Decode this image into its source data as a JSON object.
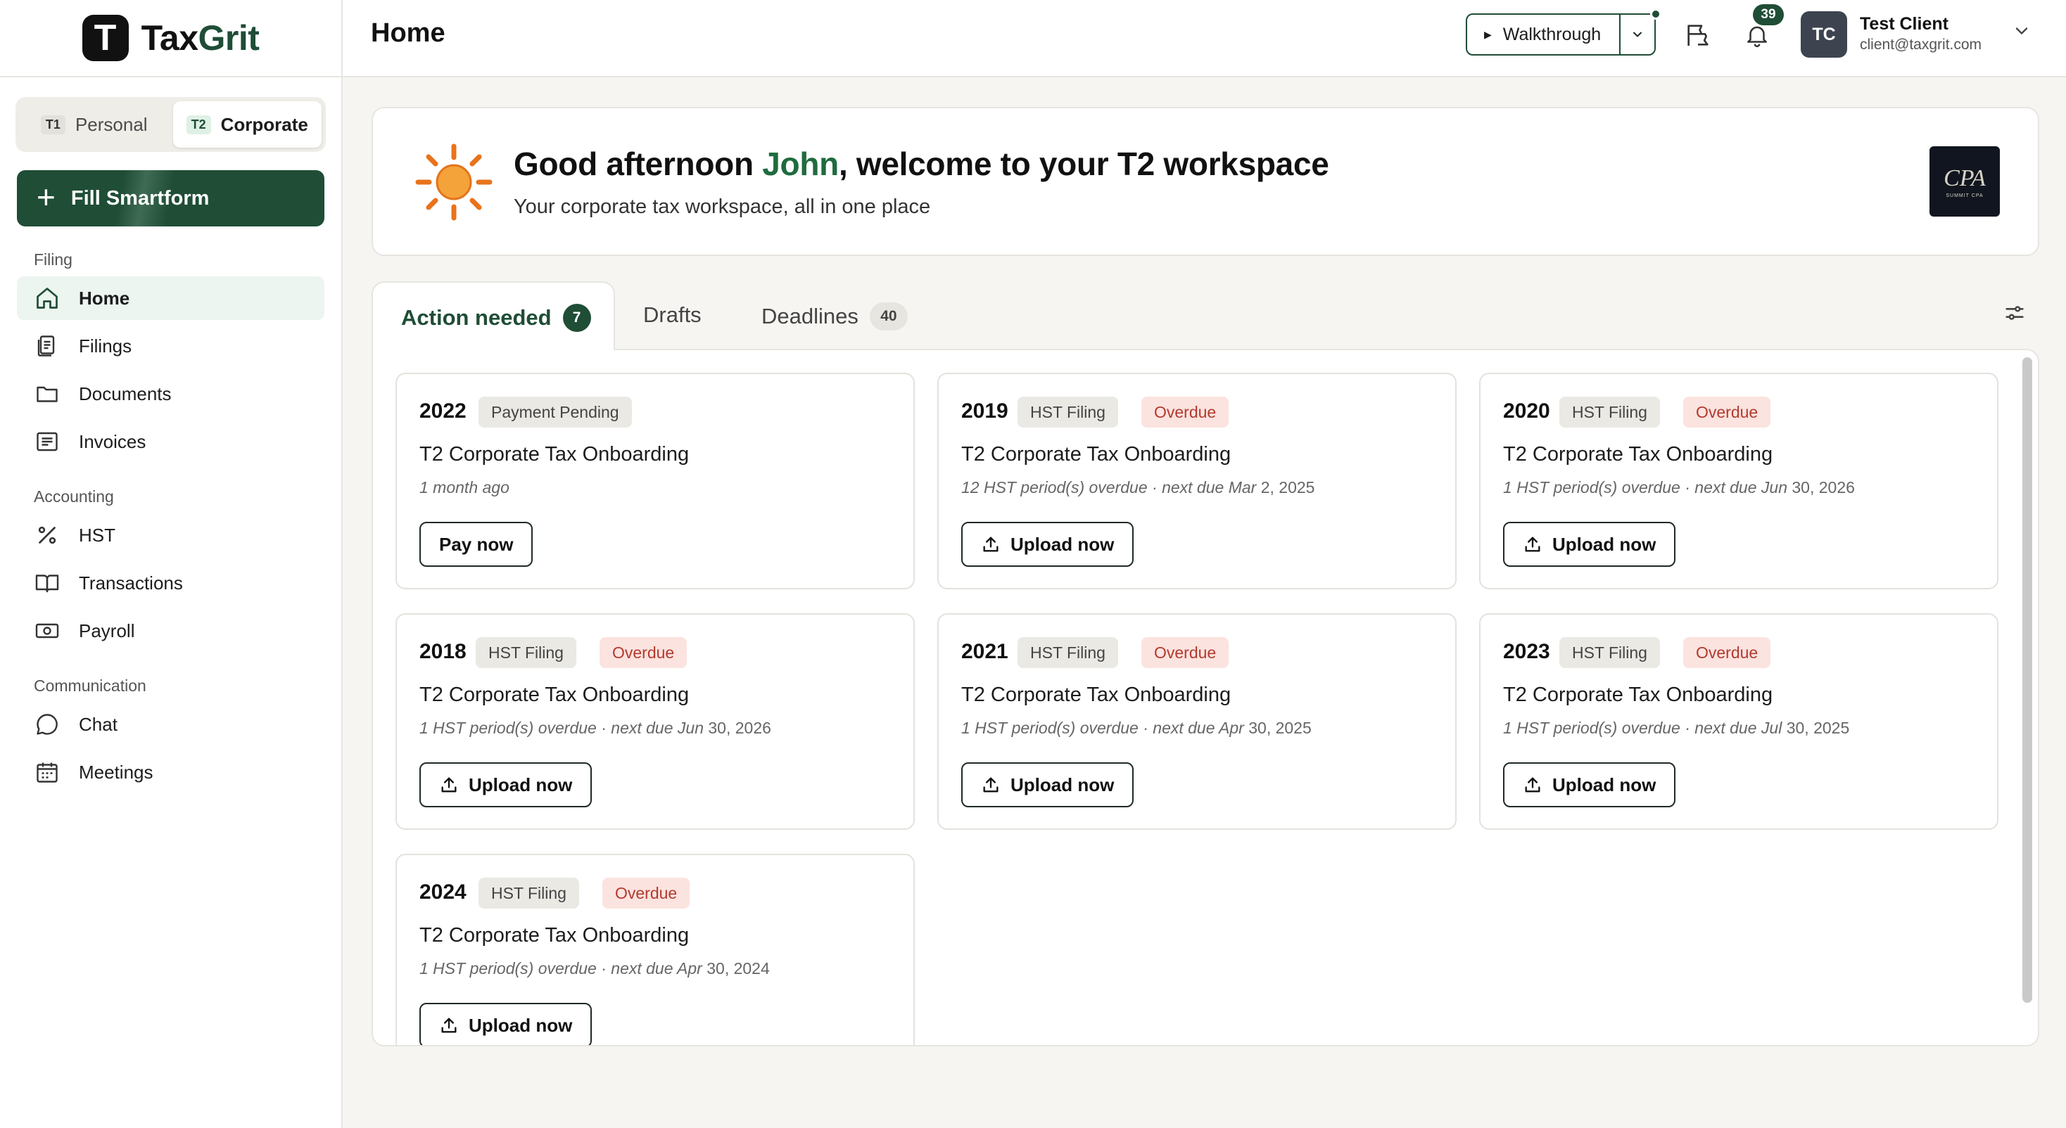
{
  "brand": {
    "name_a": "Tax",
    "name_b": "Grit",
    "mark": "T"
  },
  "mode_switch": [
    {
      "code": "T1",
      "label": "Personal",
      "active": false
    },
    {
      "code": "T2",
      "label": "Corporate",
      "active": true
    }
  ],
  "smartform": {
    "label": "Fill Smartform"
  },
  "nav": {
    "filing_label": "Filing",
    "accounting_label": "Accounting",
    "communication_label": "Communication",
    "items": {
      "home": "Home",
      "filings": "Filings",
      "documents": "Documents",
      "invoices": "Invoices",
      "hst": "HST",
      "transactions": "Transactions",
      "payroll": "Payroll",
      "chat": "Chat",
      "meetings": "Meetings"
    }
  },
  "header": {
    "title": "Home",
    "walkthrough_label": "Walkthrough",
    "notification_count": "39",
    "user": {
      "initials": "TC",
      "name": "Test Client",
      "email": "client@taxgrit.com"
    }
  },
  "welcome": {
    "greeting": "Good afternoon ",
    "name": "John",
    "rest": ", welcome to your T2 workspace",
    "subtitle": "Your corporate tax workspace, all in one place",
    "logo_text": "CPA",
    "logo_subtext": "SUMMIT CPA"
  },
  "tabs": [
    {
      "label": "Action needed",
      "count": "7"
    },
    {
      "label": "Drafts"
    },
    {
      "label": "Deadlines",
      "count": "40"
    }
  ],
  "cards": [
    {
      "year": "2022",
      "tag1": "Payment Pending",
      "title": "T2 Corporate Tax Onboarding",
      "meta": "1 month ago",
      "button": "Pay now"
    },
    {
      "year": "2019",
      "tag1": "HST Filing",
      "tag2": "Overdue",
      "title": "T2 Corporate Tax Onboarding",
      "meta_a": "12 HST period(s) overdue · next due Mar",
      "meta_b": " 2, 2025",
      "button": "Upload now"
    },
    {
      "year": "2020",
      "tag1": "HST Filing",
      "tag2": "Overdue",
      "title": "T2 Corporate Tax Onboarding",
      "meta_a": "1 HST period(s) overdue · next due Jun",
      "meta_b": " 30, 2026",
      "button": "Upload now"
    },
    {
      "year": "2018",
      "tag1": "HST Filing",
      "tag2": "Overdue",
      "title": "T2 Corporate Tax Onboarding",
      "meta_a": "1 HST period(s) overdue · next due Jun",
      "meta_b": " 30, 2026",
      "button": "Upload now"
    },
    {
      "year": "2021",
      "tag1": "HST Filing",
      "tag2": "Overdue",
      "title": "T2 Corporate Tax Onboarding",
      "meta_a": "1 HST period(s) overdue · next due Apr",
      "meta_b": " 30, 2025",
      "button": "Upload now"
    },
    {
      "year": "2023",
      "tag1": "HST Filing",
      "tag2": "Overdue",
      "title": "T2 Corporate Tax Onboarding",
      "meta_a": "1 HST period(s) overdue · next due Jul",
      "meta_b": " 30, 2025",
      "button": "Upload now"
    },
    {
      "year": "2024",
      "tag1": "HST Filing",
      "tag2": "Overdue",
      "title": "T2 Corporate Tax Onboarding",
      "meta_a": "1 HST period(s) overdue · next due Apr",
      "meta_b": " 30, 2024",
      "button": "Upload now"
    }
  ],
  "colors": {
    "accent": "#1f4d36",
    "overdue_bg": "#fbe3df",
    "overdue_text": "#b33a2e",
    "sun": "#f08a1c"
  }
}
